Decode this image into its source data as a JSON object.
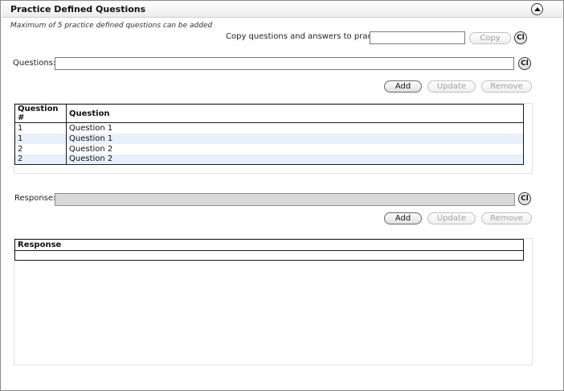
{
  "header": {
    "title": "Practice Defined Questions"
  },
  "note": "Maximum of 5 practice defined questions can be added",
  "copy_section": {
    "label": "Copy questions and answers to practice:",
    "value": "",
    "copy_label": "Copy",
    "clear_label": "Cl"
  },
  "questions_section": {
    "label": "Questions:",
    "value": "",
    "clear_label": "Cl",
    "add_label": "Add",
    "update_label": "Update",
    "remove_label": "Remove",
    "table": {
      "columns": [
        "Question #",
        "Question"
      ],
      "rows": [
        {
          "num": "1",
          "question": "Question 1"
        },
        {
          "num": "1",
          "question": "Question 1"
        },
        {
          "num": "2",
          "question": "Question 2"
        },
        {
          "num": "2",
          "question": "Question 2"
        }
      ]
    }
  },
  "response_section": {
    "label": "Response:",
    "value": "",
    "clear_label": "Cl",
    "add_label": "Add",
    "update_label": "Update",
    "remove_label": "Remove",
    "table": {
      "columns": [
        "Response"
      ]
    }
  }
}
